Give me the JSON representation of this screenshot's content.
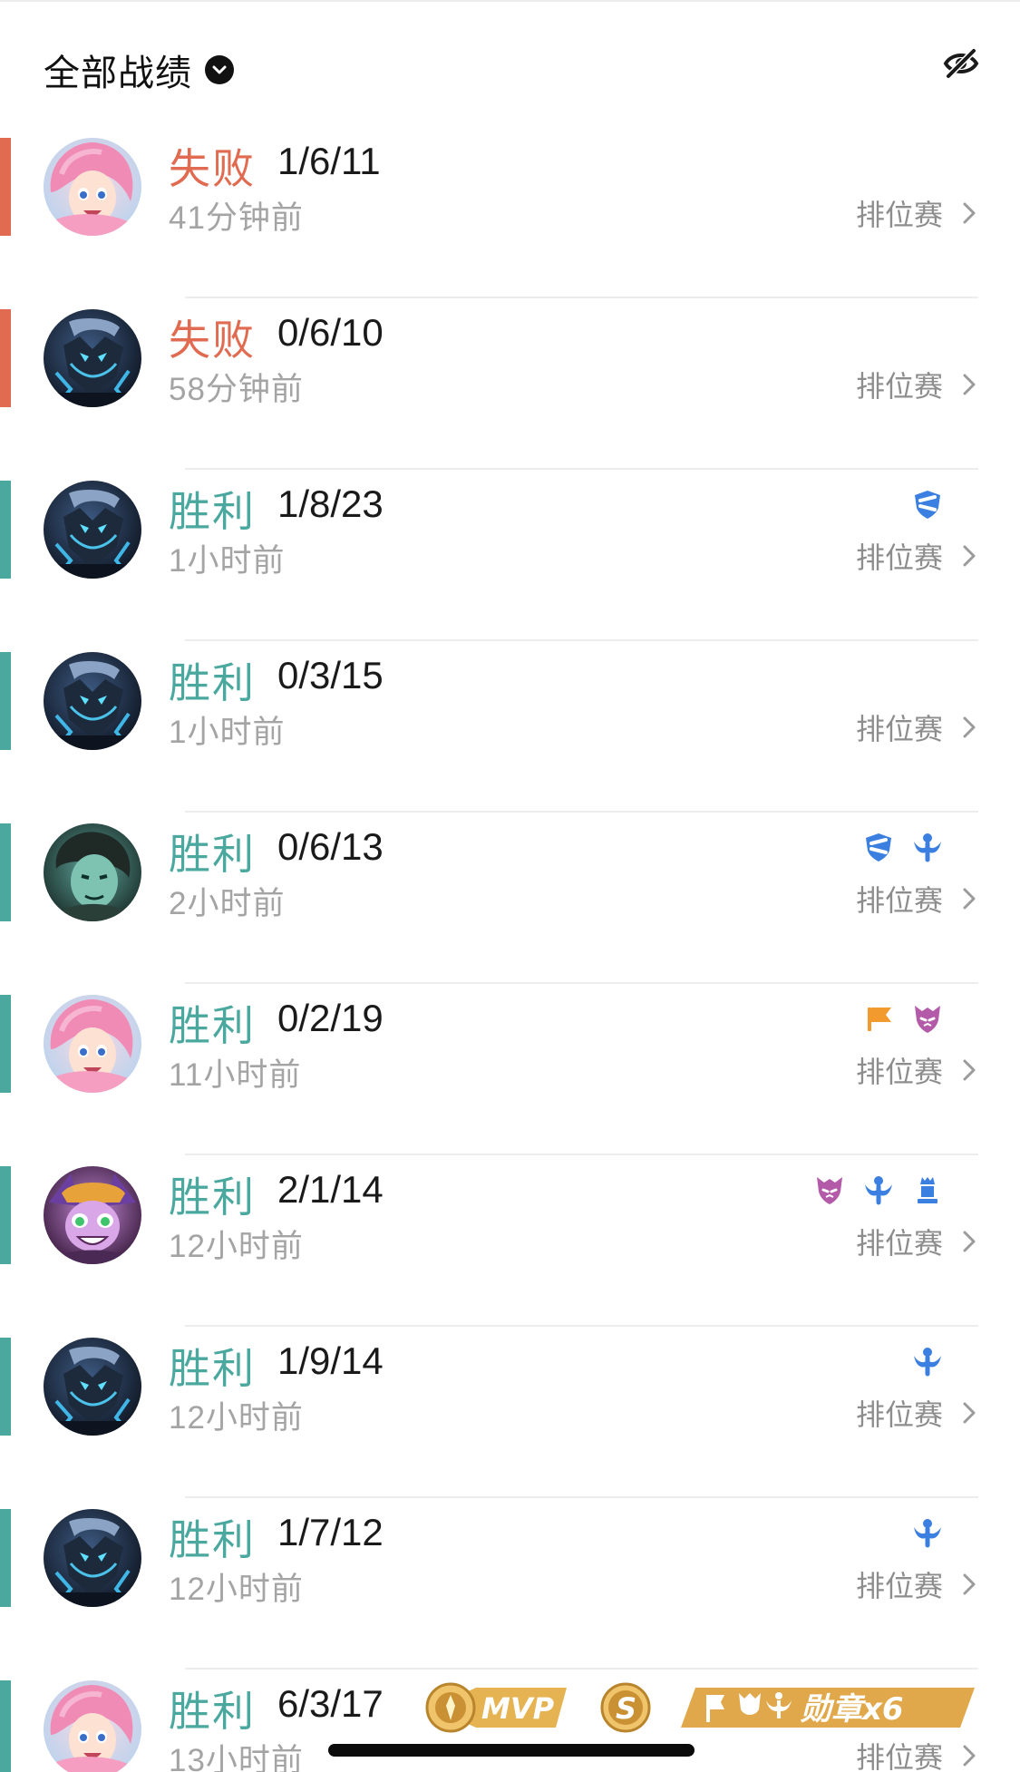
{
  "header": {
    "filter_label": "全部战绩",
    "filter_icon": "chevron-down-circle-icon",
    "visibility_icon": "eye-off-icon"
  },
  "colors": {
    "loss": "#e06b51",
    "win": "#4aa89e",
    "badge_blue": "#3b7fe0",
    "badge_orange": "#f29a2e",
    "badge_purple": "#b35aa8",
    "mvp_gold": "#e6b352"
  },
  "matches": [
    {
      "result": "失败",
      "outcome": "loss",
      "kda": "1/6/11",
      "time": "41分钟前",
      "mode": "排位赛",
      "avatar": "pink-hair-champion-avatar",
      "badges": []
    },
    {
      "result": "失败",
      "outcome": "loss",
      "kda": "0/6/10",
      "time": "58分钟前",
      "mode": "排位赛",
      "avatar": "dark-armored-champion-avatar",
      "badges": []
    },
    {
      "result": "胜利",
      "outcome": "win",
      "kda": "1/8/23",
      "time": "1小时前",
      "mode": "排位赛",
      "avatar": "dark-armored-champion-avatar",
      "badges": [
        "blue-shield-badge"
      ]
    },
    {
      "result": "胜利",
      "outcome": "win",
      "kda": "0/3/15",
      "time": "1小时前",
      "mode": "排位赛",
      "avatar": "dark-armored-champion-avatar",
      "badges": []
    },
    {
      "result": "胜利",
      "outcome": "win",
      "kda": "0/6/13",
      "time": "2小时前",
      "mode": "排位赛",
      "avatar": "green-spectre-champion-avatar",
      "badges": [
        "blue-shield-badge",
        "blue-angel-badge"
      ]
    },
    {
      "result": "胜利",
      "outcome": "win",
      "kda": "0/2/19",
      "time": "11小时前",
      "mode": "排位赛",
      "avatar": "pink-hair-champion-avatar",
      "badges": [
        "orange-flag-badge",
        "purple-demon-badge"
      ]
    },
    {
      "result": "胜利",
      "outcome": "win",
      "kda": "2/1/14",
      "time": "12小时前",
      "mode": "排位赛",
      "avatar": "purple-yordle-champion-avatar",
      "badges": [
        "purple-demon-badge",
        "blue-angel-badge",
        "blue-tower-badge"
      ]
    },
    {
      "result": "胜利",
      "outcome": "win",
      "kda": "1/9/14",
      "time": "12小时前",
      "mode": "排位赛",
      "avatar": "dark-armored-champion-avatar",
      "badges": [
        "blue-angel-badge"
      ]
    },
    {
      "result": "胜利",
      "outcome": "win",
      "kda": "1/7/12",
      "time": "12小时前",
      "mode": "排位赛",
      "avatar": "dark-armored-champion-avatar",
      "badges": [
        "blue-angel-badge"
      ]
    },
    {
      "result": "胜利",
      "outcome": "win",
      "kda": "6/3/17",
      "time": "13小时前",
      "mode": "排位赛",
      "avatar": "pink-hair-champion-avatar",
      "badges": []
    }
  ],
  "last_row_awards": {
    "mvp_label": "MVP",
    "s_label": "S",
    "medal_label": "勋章x6"
  }
}
